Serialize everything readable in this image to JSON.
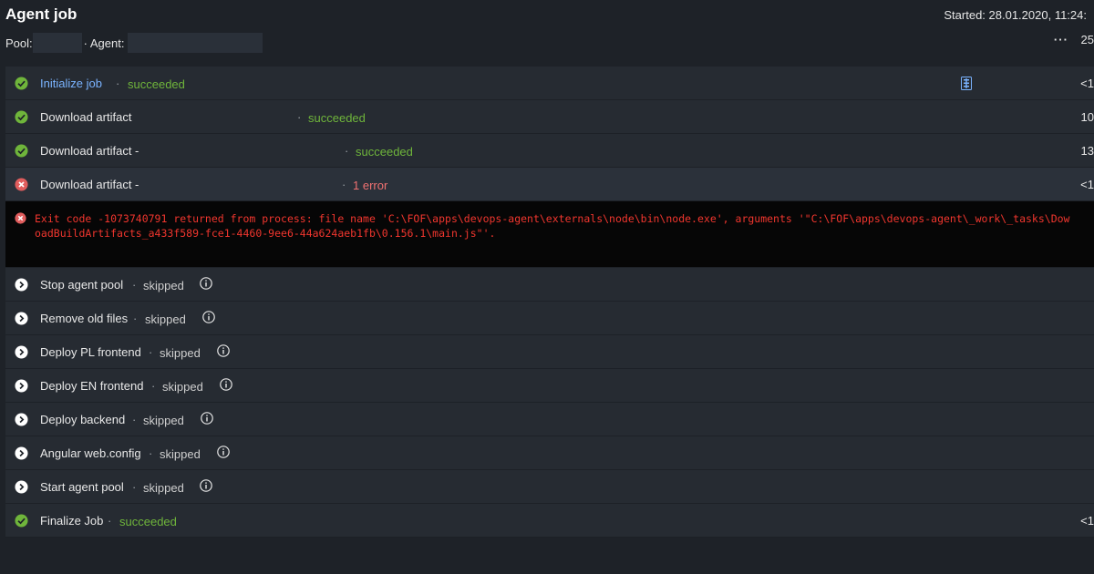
{
  "header": {
    "title": "Agent job",
    "started": "Started: 28.01.2020, 11:24:",
    "pool_label": "Pool:",
    "agent_label": "· Agent:",
    "more_text": "25"
  },
  "steps": [
    {
      "name": "Initialize job",
      "status": "succeeded",
      "state": "success",
      "duration": "<1"
    },
    {
      "name": "Download artifact",
      "status": "succeeded",
      "state": "success",
      "duration": "10"
    },
    {
      "name": "Download artifact -",
      "status": "succeeded",
      "state": "success",
      "duration": "13"
    },
    {
      "name": "Download artifact -",
      "status": "1 error",
      "state": "error",
      "duration": "<1"
    },
    {
      "name": "Stop agent pool",
      "status": "skipped",
      "state": "skipped",
      "duration": ""
    },
    {
      "name": "Remove old files",
      "status": "skipped",
      "state": "skipped",
      "duration": ""
    },
    {
      "name": "Deploy PL frontend",
      "status": "skipped",
      "state": "skipped",
      "duration": ""
    },
    {
      "name": "Deploy EN frontend",
      "status": "skipped",
      "state": "skipped",
      "duration": ""
    },
    {
      "name": "Deploy backend",
      "status": "skipped",
      "state": "skipped",
      "duration": ""
    },
    {
      "name": "Angular web.config",
      "status": "skipped",
      "state": "skipped",
      "duration": ""
    },
    {
      "name": "Start agent pool",
      "status": "skipped",
      "state": "skipped",
      "duration": ""
    },
    {
      "name": "Finalize Job",
      "status": "succeeded",
      "state": "success",
      "duration": "<1"
    }
  ],
  "error": {
    "line1": "Exit code -1073740791 returned from process: file name 'C:\\FOF\\apps\\devops-agent\\externals\\node\\bin\\node.exe', arguments '\"C:\\FOF\\apps\\devops-agent\\_work\\_tasks\\Dow",
    "line2": "oadBuildArtifacts_a433f589-fce1-4460-9ee6-44a624aeb1fb\\0.156.1\\main.js\"'."
  },
  "colors": {
    "success": "#6fb53b",
    "error": "#e05d5d",
    "link": "#7ab3ff",
    "background": "#1e2228",
    "panel": "#262b32"
  },
  "icons": {
    "success": "check-circle-icon",
    "error": "error-circle-icon",
    "skipped": "skip-circle-icon",
    "info": "info-icon",
    "log": "log-file-icon",
    "more": "more-icon"
  }
}
